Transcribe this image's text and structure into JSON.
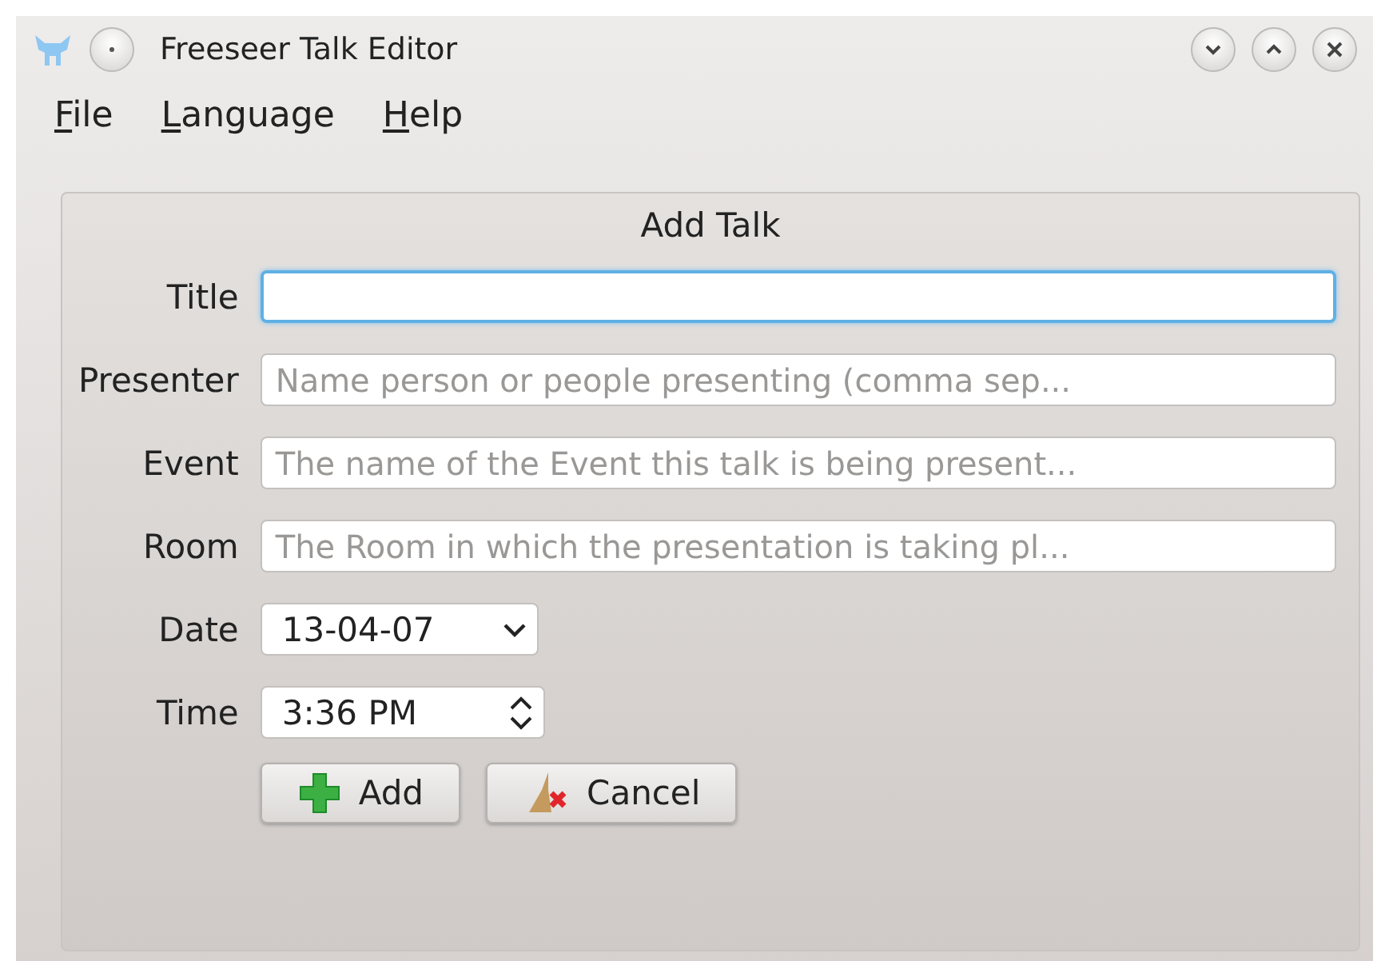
{
  "window": {
    "title": "Freeseer Talk Editor"
  },
  "menu": [
    {
      "label": "File"
    },
    {
      "label": "Language"
    },
    {
      "label": "Help"
    }
  ],
  "group": {
    "title": "Add Talk"
  },
  "fields": [
    {
      "kind": "text",
      "label": "Title",
      "focused": true
    },
    {
      "kind": "text",
      "label": "Presenter",
      "placeholder": "Name person or people presenting (comma sep...",
      "focused": false
    },
    {
      "kind": "text",
      "label": "Event",
      "placeholder": "The name of the Event this talk is being present...",
      "focused": false
    },
    {
      "kind": "text",
      "label": "Room",
      "placeholder": "The Room in which the presentation is taking pl...",
      "focused": false
    },
    {
      "kind": "date",
      "label": "Date",
      "value": "13-04-07"
    },
    {
      "kind": "time",
      "label": "Time",
      "value": "3:36 PM"
    }
  ],
  "buttons": [
    {
      "kind": "add",
      "label": "Add"
    },
    {
      "kind": "cancel",
      "label": "Cancel"
    }
  ]
}
